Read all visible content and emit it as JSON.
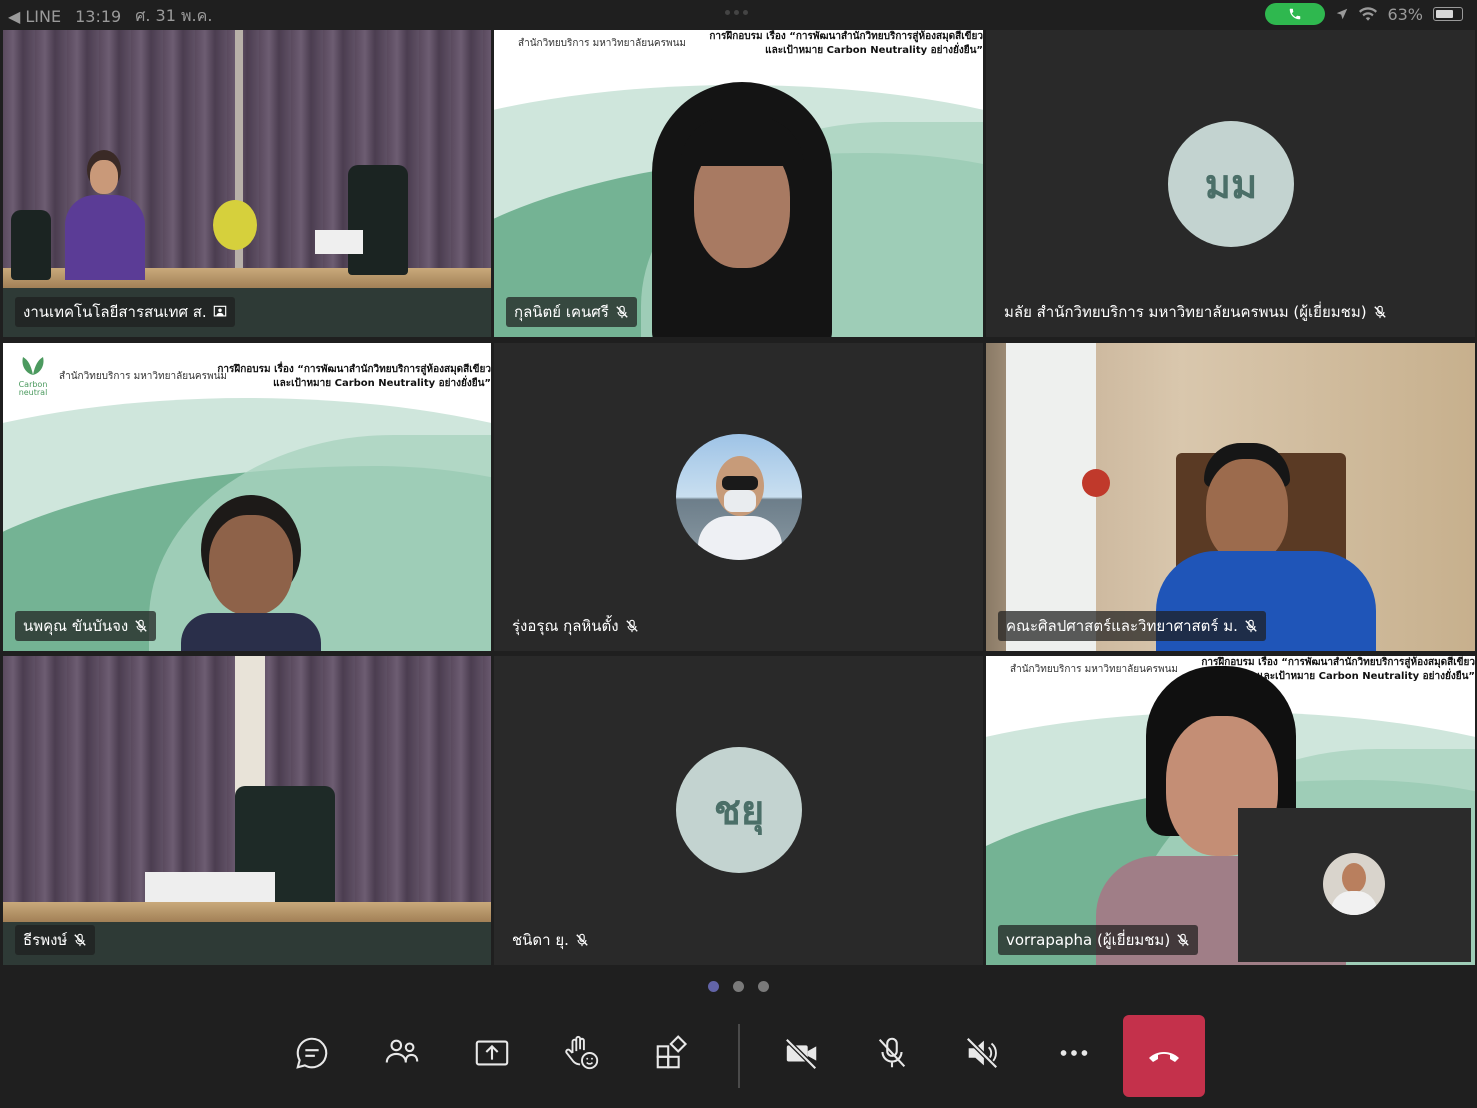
{
  "status": {
    "back_app": "◀ LINE",
    "time": "13:19",
    "date": "ศ. 31 พ.ค.",
    "battery": "63%"
  },
  "slide": {
    "org": "สำนักวิทยบริการ มหาวิทยาลัยนครพนม",
    "title_line1": "การฝึกอบรม เรื่อง “การพัฒนาสำนักวิทยบริการสู่ห้องสมุดสีเขียว",
    "title_line2": "และเป้าหมาย Carbon Neutrality อย่างยั่งยืน”",
    "logo_text": "Carbon neutral"
  },
  "participants": [
    {
      "name": "งานเทคโนโลยีสารสนเทศ ส.",
      "type": "video-room"
    },
    {
      "name": "กุลนิตย์  เคนศรี",
      "type": "video-slide"
    },
    {
      "name": "มลัย สำนักวิทยบริการ มหาวิทยาลัยนครพนม (ผู้เยี่ยมชม)",
      "type": "avatar",
      "initials": "มม"
    },
    {
      "name": "นพคุณ  ขันบันจง",
      "type": "video-slide"
    },
    {
      "name": "รุ่งอรุณ  กุลหินตั้ง",
      "type": "avatar-photo"
    },
    {
      "name": "คณะศิลปศาสตร์และวิทยาศาสตร์ ม.",
      "type": "video-office"
    },
    {
      "name": "ธีรพงษ์",
      "type": "video-room"
    },
    {
      "name": "ชนิดา ยุ.",
      "type": "avatar",
      "initials": "ชยุ"
    },
    {
      "name": "vorrapapha (ผู้เยี่ยมชม)",
      "type": "video-slide"
    }
  ],
  "pagination": {
    "total": 3,
    "current": 1
  },
  "toolbar": {
    "icons": [
      "chat-icon",
      "people-icon",
      "share-screen-icon",
      "raise-hand-icon",
      "apps-icon",
      "camera-off-icon",
      "mic-off-icon",
      "speaker-off-icon",
      "more-icon",
      "hang-up-icon"
    ]
  },
  "colors": {
    "accent": "#6264a7",
    "hangup": "#c4314b",
    "call_pill": "#2fb84f",
    "avatar_bg": "#c3d3d0",
    "slide_green": "#74b394"
  }
}
